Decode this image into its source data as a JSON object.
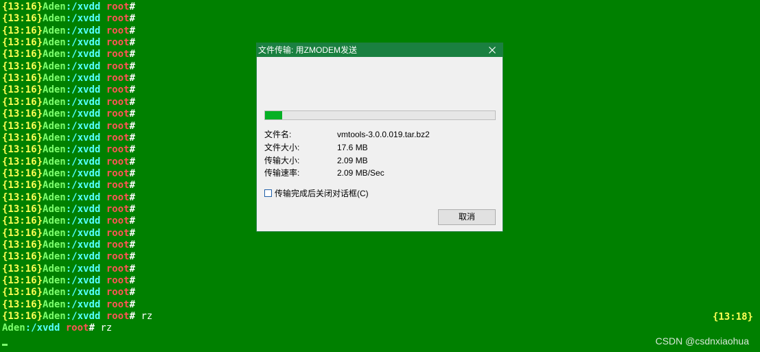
{
  "terminal": {
    "prompt": {
      "time": "{13:16}",
      "host": "Aden",
      "path": ":/xvdd",
      "user": "root",
      "hash": "#"
    },
    "prompt_line_count": 26,
    "command_line": {
      "time": "{13:16}",
      "host": "Aden",
      "path": ":/xvdd",
      "user": "root",
      "hash": "#",
      "command": " rz"
    },
    "last_line": {
      "host": "Aden",
      "path": ":/xvdd",
      "user": "root",
      "hash": "#",
      "command": " rz"
    },
    "right_time": "{13:18}"
  },
  "dialog": {
    "title": "文件传输: 用ZMODEM发送",
    "close_symbol": "×",
    "progress_percent": 7.5,
    "fields": [
      {
        "label": "文件名:",
        "value": "vmtools-3.0.0.019.tar.bz2"
      },
      {
        "label": "文件大小:",
        "value": "17.6 MB"
      },
      {
        "label": "传输大小:",
        "value": "2.09 MB"
      },
      {
        "label": "传输速率:",
        "value": "2.09 MB/Sec"
      }
    ],
    "checkbox_label": "传输完成后关闭对话框(C)",
    "checkbox_checked": false,
    "cancel_label": "取消"
  },
  "watermark": "CSDN @csdnxiaohua",
  "colors": {
    "terminal_bg": "#008000",
    "time": "#ffff55",
    "host": "#7dff6e",
    "path": "#55ffff",
    "user": "#ff5555",
    "titlebar": "#1a8040",
    "progress": "#06b025"
  }
}
